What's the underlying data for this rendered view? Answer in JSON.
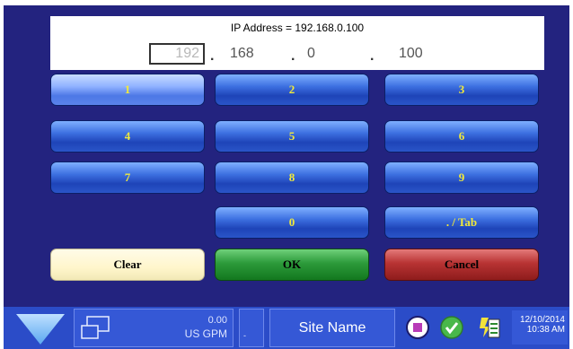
{
  "display": {
    "title": "IP Address = 192.168.0.100",
    "octets": [
      "192",
      "168",
      "0",
      "100"
    ],
    "separator": "."
  },
  "keypad": {
    "keys": [
      "1",
      "2",
      "3",
      "4",
      "5",
      "6",
      "7",
      "8",
      "9",
      "0",
      ". / Tab"
    ],
    "clear_label": "Clear",
    "ok_label": "OK",
    "cancel_label": "Cancel"
  },
  "statusbar": {
    "flow_value": "0.00",
    "flow_unit": "US GPM",
    "small_text": "-",
    "site_name": "Site Name",
    "date": "12/10/2014",
    "time": "10:38 AM",
    "icons": [
      "menu-down-arrow-icon",
      "window-icon",
      "stop-icon",
      "check-icon",
      "data-log-icon"
    ]
  },
  "colors": {
    "background": "#23237f",
    "key_blue": "#2a55c8",
    "key_text": "#f2ea3a",
    "ok_green": "#2c9a3a",
    "cancel_red": "#b83333",
    "clear_cream": "#fff6cc",
    "statusbar": "#2b4cc8"
  }
}
